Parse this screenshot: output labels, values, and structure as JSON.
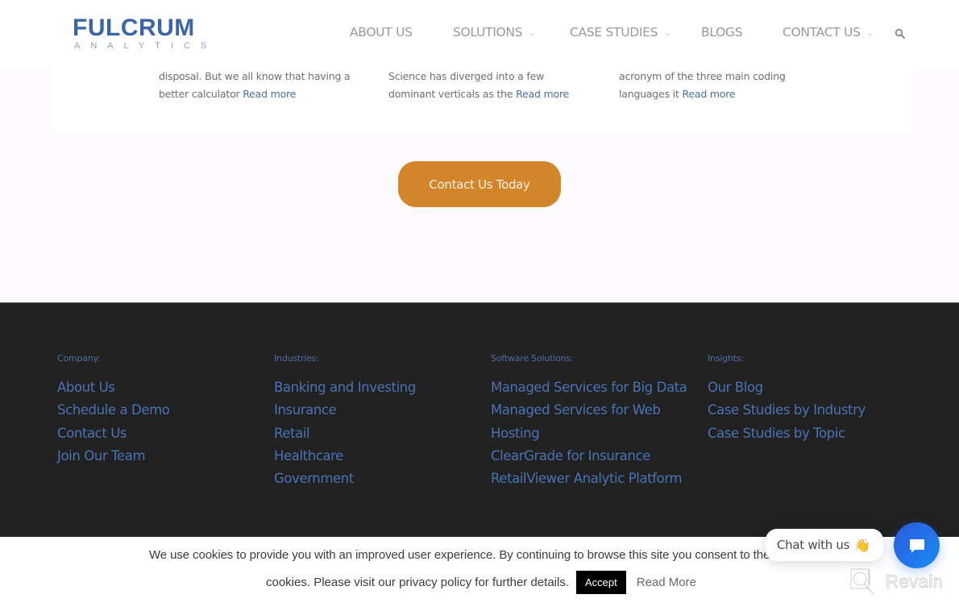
{
  "header": {
    "logo_main": "FULCRUM",
    "logo_sub": "ANALYTICS",
    "nav": [
      {
        "label": "ABOUT US",
        "has_dropdown": false
      },
      {
        "label": "SOLUTIONS",
        "has_dropdown": true
      },
      {
        "label": "CASE STUDIES",
        "has_dropdown": true
      },
      {
        "label": "BLOGS",
        "has_dropdown": false
      },
      {
        "label": "CONTACT US",
        "has_dropdown": true
      }
    ],
    "search_icon": "search-icon",
    "chevron_glyph": "⌄"
  },
  "cards": [
    {
      "line1": "disposal. But we all know that having a",
      "line2": "better calculator",
      "read_more": "Read more"
    },
    {
      "line1": "Science has diverged into a few",
      "line2": "dominant verticals as the",
      "read_more": "Read more"
    },
    {
      "line1": "acronym of the three main coding",
      "line2": "languages it",
      "read_more": "Read more"
    }
  ],
  "cta": {
    "label": "Contact Us Today",
    "color": "#d2852b"
  },
  "footer": {
    "columns": [
      {
        "heading": "Company:",
        "links": [
          "About Us",
          "Schedule a Demo",
          "Contact Us",
          "Join Our Team"
        ]
      },
      {
        "heading": "Industries:",
        "links": [
          "Banking and Investing",
          "Insurance",
          "Retail",
          "Healthcare",
          "Government"
        ]
      },
      {
        "heading": "Software Solutions:",
        "links": [
          "Managed Services for Big Data",
          "Managed Services for Web",
          "Hosting",
          "ClearGrade for Insurance",
          "RetailViewer Analytic Platform"
        ]
      },
      {
        "heading": "Insights:",
        "links": [
          "Our Blog",
          "Case Studies by Industry",
          "Case Studies by Topic"
        ]
      }
    ],
    "link_color": "#4a73b5",
    "background": "#212121"
  },
  "cookie": {
    "line1": "We use cookies to provide you with an improved user experience. By continuing to browse this site you consent to the use of",
    "line2": "cookies. Please visit our privacy policy for further details.",
    "accept_label": "Accept",
    "read_more_label": "Read More"
  },
  "chat": {
    "bubble_text": "Chat with us",
    "wave_emoji": "👋",
    "button_icon": "chat-icon"
  },
  "watermark": {
    "text": "Revain"
  }
}
